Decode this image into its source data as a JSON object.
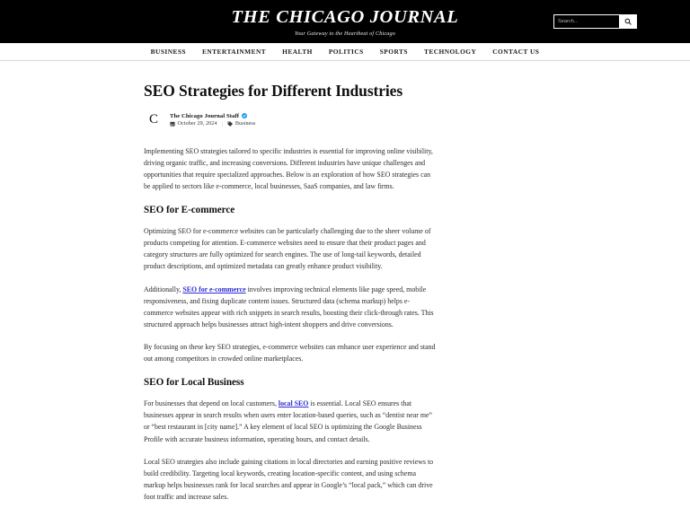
{
  "header": {
    "brand_title": "THE CHICAGO JOURNAL",
    "tagline": "Your Gateway to the Heartbeat of Chicago",
    "search": {
      "placeholder": "Search...",
      "value": "",
      "icon": "search-icon"
    },
    "background_color": "#000000"
  },
  "nav": {
    "items": [
      {
        "label": "BUSINESS"
      },
      {
        "label": "ENTERTAINMENT"
      },
      {
        "label": "HEALTH"
      },
      {
        "label": "POLITICS"
      },
      {
        "label": "SPORTS"
      },
      {
        "label": "TECHNOLOGY"
      },
      {
        "label": "CONTACT US"
      }
    ]
  },
  "article": {
    "title": "SEO Strategies for Different Industries",
    "avatar_letter": "C",
    "author": "The Chicago Journal Staff",
    "verified": true,
    "verified_color": "#1d9bf0",
    "date": "October 29, 2024",
    "date_icon": "calendar-icon",
    "category": "Business",
    "category_icon": "tag-icon",
    "meta_separator": "|",
    "link_color": "#2b2bd4",
    "intro": "Implementing SEO strategies tailored to specific industries is essential for improving online visibility, driving organic traffic, and increasing conversions. Different industries have unique challenges and opportunities that require specialized approaches. Below is an exploration of how SEO strategies can be applied to sectors like e-commerce, local businesses, SaaS companies, and law firms.",
    "sections": [
      {
        "heading": "SEO for E-commerce",
        "p1": "Optimizing SEO for e-commerce websites can be particularly challenging due to the sheer volume of products competing for attention. E-commerce websites need to ensure that their product pages and category structures are fully optimized for search engines. The use of long-tail keywords, detailed product descriptions, and optimized metadata can greatly enhance product visibility.",
        "p2_before": "Additionally, ",
        "p2_link": "SEO for e-commerce",
        "p2_after": " involves improving technical elements like page speed, mobile responsiveness, and fixing duplicate content issues. Structured data (schema markup) helps e-commerce websites appear with rich snippets in search results, boosting their click-through rates. This structured approach helps businesses attract high-intent shoppers and drive conversions.",
        "p3": "By focusing on these key SEO strategies, e-commerce websites can enhance user experience and stand out among competitors in crowded online marketplaces."
      },
      {
        "heading": "SEO for Local Business",
        "p1_before": "For businesses that depend on local customers, ",
        "p1_link": "local SEO",
        "p1_after": " is essential. Local SEO ensures that businesses appear in search results when users enter location-based queries, such as “dentist near me” or “best restaurant in [city name].” A key element of local SEO is optimizing the Google Business Profile with accurate business information, operating hours, and contact details.",
        "p2": "Local SEO strategies also include gaining citations in local directories and earning positive reviews to build credibility. Targeting local keywords, creating location-specific content, and using schema markup helps businesses rank for local searches and appear in Google’s “local pack,” which can drive foot traffic and increase sales."
      }
    ]
  }
}
